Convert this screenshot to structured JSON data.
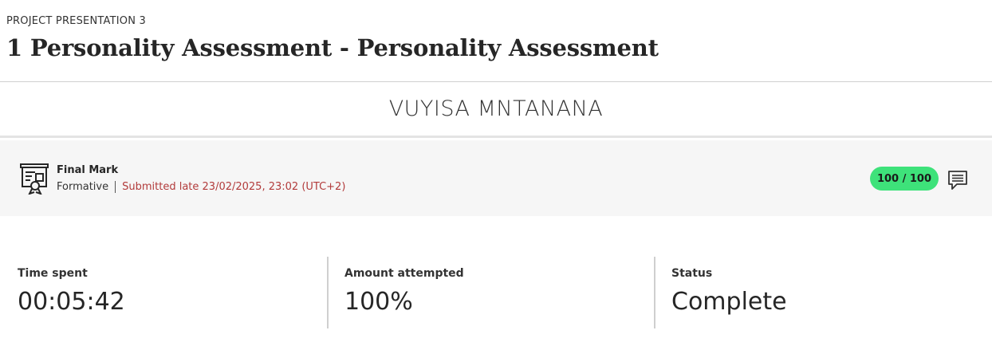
{
  "header": {
    "breadcrumb": "PROJECT PRESENTATION 3",
    "title": "1 Personality Assessment - Personality Assessment"
  },
  "student": {
    "name": "VUYISA MNTANANA"
  },
  "mark": {
    "icon": "certificate-icon",
    "title": "Final Mark",
    "type": "Formative",
    "submission": "Submitted late 23/02/2025, 23:02 (UTC+2)",
    "score": "100 / 100",
    "score_color": "#3ee27a",
    "late_color": "#b23b3b",
    "comment_icon": "comment-icon"
  },
  "stats": [
    {
      "label": "Time spent",
      "value": "00:05:42"
    },
    {
      "label": "Amount attempted",
      "value": "100%"
    },
    {
      "label": "Status",
      "value": "Complete"
    }
  ]
}
